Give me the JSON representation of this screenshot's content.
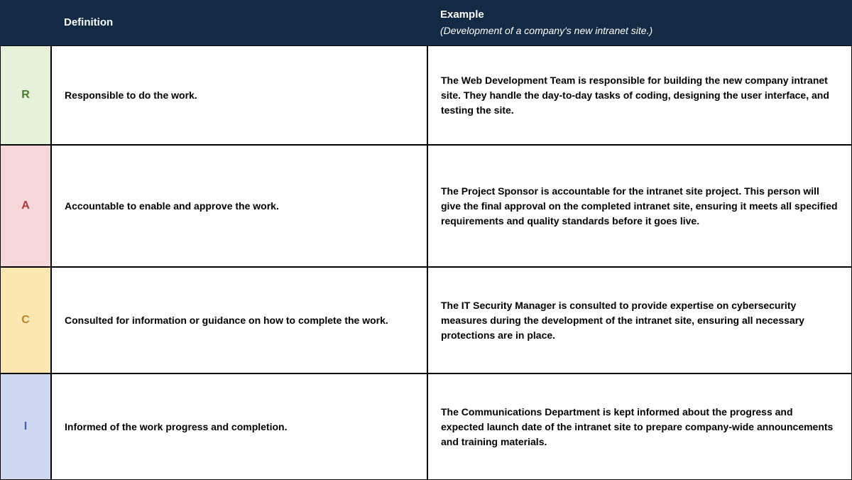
{
  "header": {
    "definition": "Definition",
    "example_title": "Example",
    "example_subtitle": "(Development of a company's new intranet site.)"
  },
  "rows": [
    {
      "letter": "R",
      "def_bold": "Responsible",
      "def_rest": " to do the work.",
      "ex_pre": "The Web Development Team is ",
      "ex_bold": "responsible",
      "ex_post": " for building the new company intranet site. They handle the day-to-day tasks of coding, designing the user interface, and testing the site."
    },
    {
      "letter": "A",
      "def_bold": "Accountable",
      "def_rest": " to enable and approve the work.",
      "ex_pre": "The Project Sponsor is ",
      "ex_bold": "accountable",
      "ex_post": " for the intranet site project. This person will give the final approval on the completed intranet site, ensuring it meets all specified requirements and quality standards before it goes live."
    },
    {
      "letter": "C",
      "def_bold": "Consulted",
      "def_rest": " for information or guidance on how to complete the work.",
      "ex_pre": "The IT Security Manager is ",
      "ex_bold": "consulted",
      "ex_post": " to provide expertise on cybersecurity measures during the development of the intranet site, ensuring all necessary protections are in place."
    },
    {
      "letter": "I",
      "def_bold": "Informed",
      "def_rest": " of the work progress and completion.",
      "ex_pre": "The Communications Department is kept ",
      "ex_bold": "informed",
      "ex_post": " about the progress and expected launch date of the intranet site to prepare company-wide announcements and training materials."
    }
  ],
  "colors": {
    "r_bg": "#e5f1d8",
    "a_bg": "#f7d7d9",
    "c_bg": "#fbe8b0",
    "i_bg": "#ced8ef",
    "header_bg": "#132a45"
  }
}
